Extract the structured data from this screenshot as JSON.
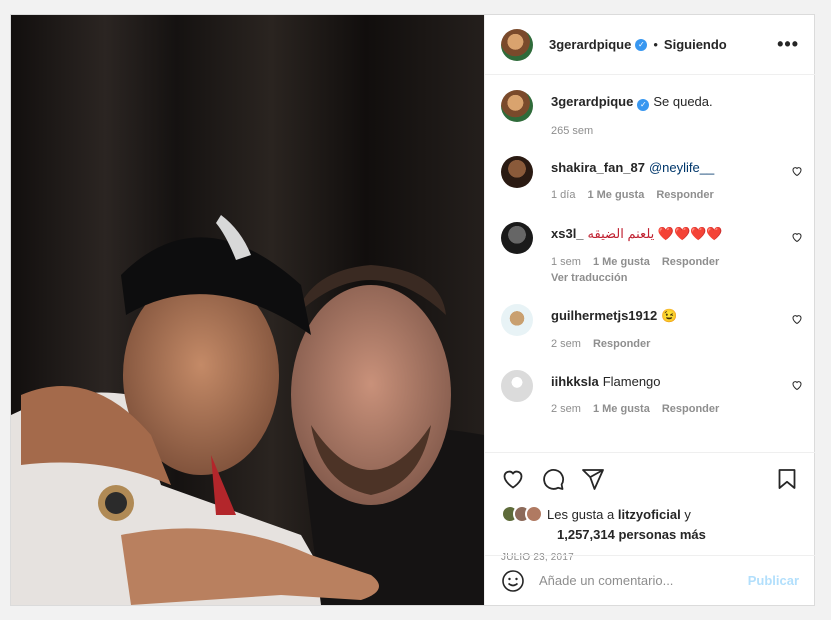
{
  "header": {
    "username": "3gerardpique",
    "separator": "•",
    "follow_status": "Siguiendo",
    "more": "•••"
  },
  "caption": {
    "username": "3gerardpique",
    "text": "Se queda.",
    "time": "265 sem"
  },
  "comments": [
    {
      "username": "shakira_fan_87",
      "text": "@neylife__",
      "time": "1 día",
      "likes": "1 Me gusta",
      "reply": "Responder",
      "translate": ""
    },
    {
      "username": "xs3l_",
      "text": "يلعنم الضيقه ❤️❤️❤️❤️",
      "time": "1 sem",
      "likes": "1 Me gusta",
      "reply": "Responder",
      "translate": "Ver traducción"
    },
    {
      "username": "guilhermetjs1912",
      "text": "😉",
      "time": "2 sem",
      "likes": "",
      "reply": "Responder",
      "translate": ""
    },
    {
      "username": "iihkksla",
      "text": "Flamengo",
      "time": "2 sem",
      "likes": "1 Me gusta",
      "reply": "Responder",
      "translate": ""
    }
  ],
  "likes": {
    "prefix": "Les gusta a",
    "user": "litzyoficial",
    "connector": "y",
    "count": "1,257,314 personas más"
  },
  "date": "JULIO 23, 2017",
  "add_comment": {
    "placeholder": "Añade un comentario...",
    "publish": "Publicar"
  },
  "colors": {
    "link": "#00376b",
    "verified": "#3897f0",
    "publish": "#b2dffc"
  }
}
